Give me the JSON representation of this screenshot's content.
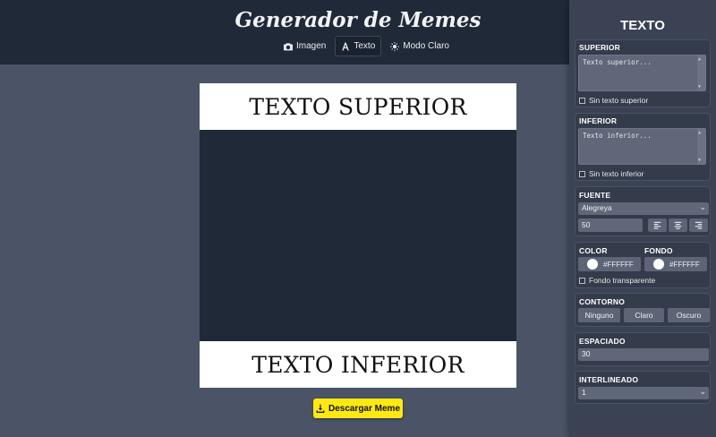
{
  "app": {
    "title": "Generador de Memes"
  },
  "nav": [
    {
      "label": "Imagen",
      "icon": "camera-icon",
      "active": false
    },
    {
      "label": "Texto",
      "icon": "font-icon",
      "active": true
    },
    {
      "label": "Modo Claro",
      "icon": "sun-icon",
      "active": false
    }
  ],
  "meme": {
    "top_text": "TEXTO SUPERIOR",
    "bottom_text": "TEXTO INFERIOR",
    "image_bg": "#1f2937"
  },
  "download": {
    "label": "Descargar Meme",
    "color": "#fde814"
  },
  "panel": {
    "title": "TEXTO",
    "superior": {
      "label": "SUPERIOR",
      "placeholder": "Texto superior...",
      "checkbox": "Sin texto superior"
    },
    "inferior": {
      "label": "INFERIOR",
      "placeholder": "Texto inferior...",
      "checkbox": "Sin texto inferior"
    },
    "fuente": {
      "label": "FUENTE",
      "value": "Alegreya",
      "size": "50"
    },
    "color": {
      "label": "COLOR",
      "value": "#FFFFFF"
    },
    "fondo": {
      "label": "FONDO",
      "value": "#FFFFFF",
      "checkbox": "Fondo transparente"
    },
    "contorno": {
      "label": "CONTORNO",
      "options": [
        "Ninguno",
        "Claro",
        "Oscuro"
      ]
    },
    "espaciado": {
      "label": "ESPACIADO",
      "value": "30"
    },
    "interlineado": {
      "label": "INTERLINEADO",
      "value": "1"
    }
  }
}
